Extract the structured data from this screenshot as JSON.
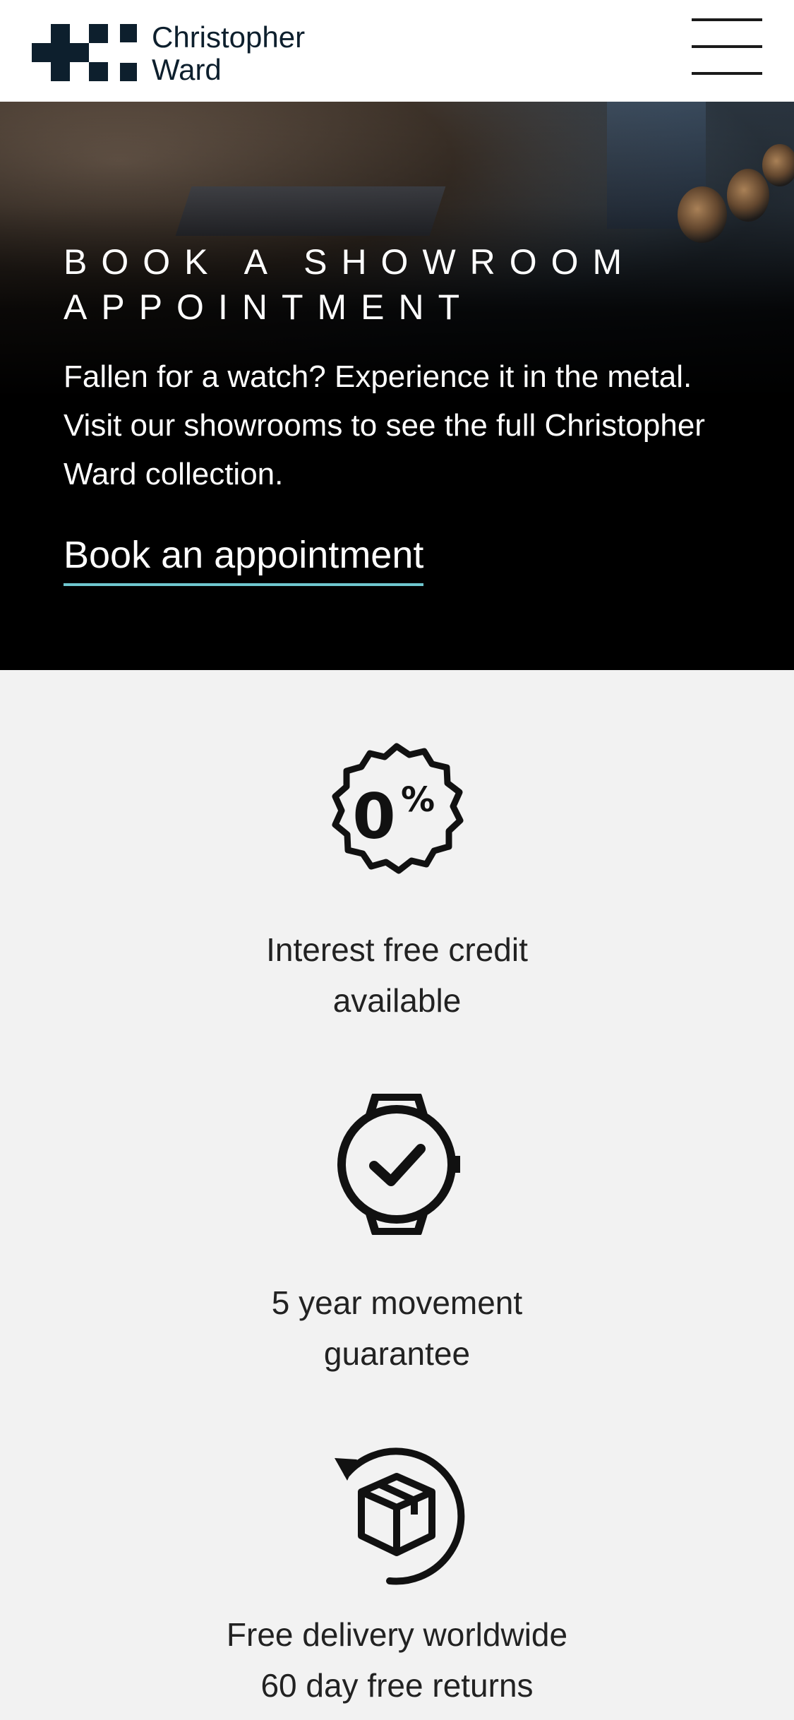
{
  "header": {
    "brand_line1": "Christopher",
    "brand_line2": "Ward",
    "logo_icon": "christopher-ward-logo",
    "menu_icon": "hamburger-menu-icon"
  },
  "hero": {
    "title_line1": "BOOK A SHOWROOM",
    "title_line2": "APPOINTMENT",
    "description": "Fallen for a watch? Experience it in the metal. Visit our showrooms to see the full Christopher Ward collection.",
    "cta_label": "Book an appointment",
    "cta_underline_color": "#6fc6cf"
  },
  "features": [
    {
      "icon": "zero-percent-badge-icon",
      "line1": "Interest free credit",
      "line2": "available"
    },
    {
      "icon": "watch-check-icon",
      "line1": "5 year movement",
      "line2": "guarantee"
    },
    {
      "icon": "box-return-icon",
      "line1": "Free delivery worldwide",
      "line2": "60 day free returns"
    }
  ],
  "colors": {
    "brand_navy": "#0d1f2d",
    "accent_teal": "#6fc6cf",
    "section_bg": "#f2f2f2"
  }
}
